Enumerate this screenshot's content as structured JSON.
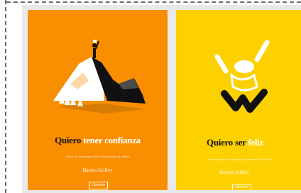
{
  "books": [
    {
      "title_main": "Quiero",
      "title_accent": "tener confianza",
      "subtitle": "Cómo ser más seguro de ti mismo y vivir sin miedo",
      "author": "Harriet Griffey",
      "publisher_badge": "Librooks",
      "background": "#f98e00",
      "illustration": "mountain-summit-icon"
    },
    {
      "title_main": "Quiero ser",
      "title_accent": "feliz",
      "subtitle": "Claves para vivir con alegría y construir tu felicidad",
      "author": "Harriet Griffey",
      "publisher_badge": "Librooks",
      "background": "#fdd000",
      "illustration": "jumping-person-icon"
    }
  ]
}
